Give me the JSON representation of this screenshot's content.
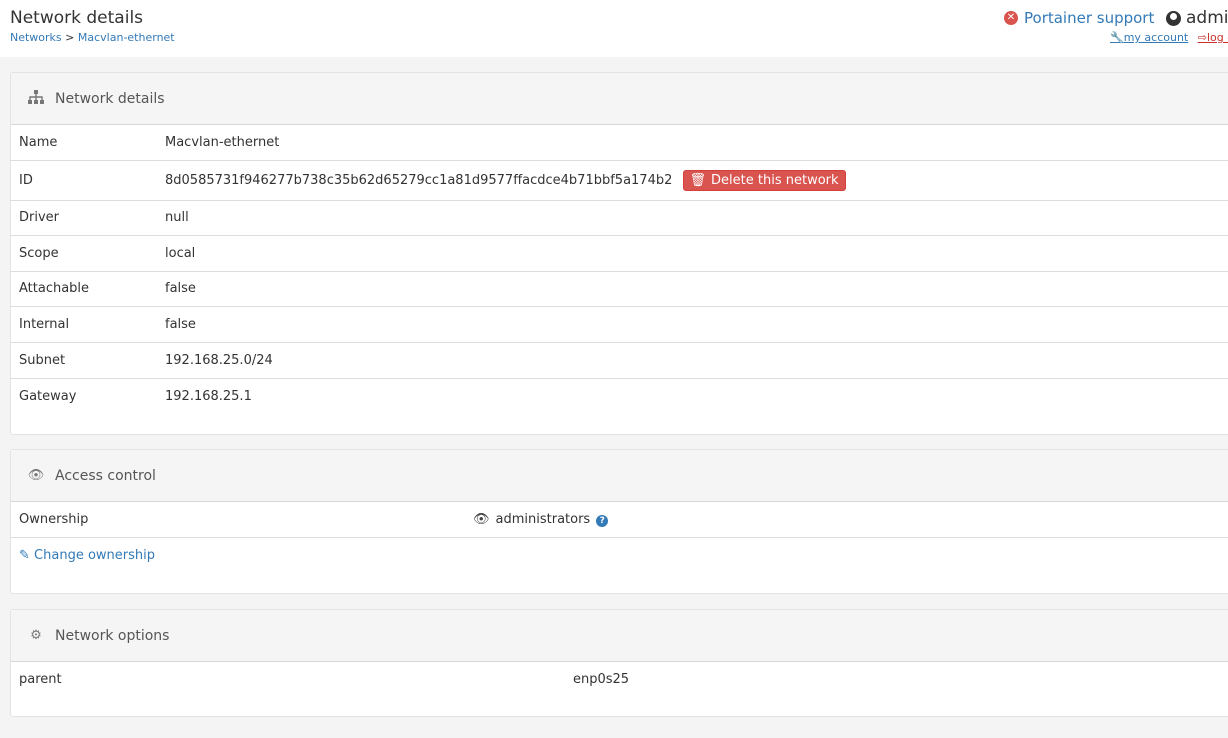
{
  "header": {
    "title": "Network details",
    "breadcrumb_root": "Networks",
    "breadcrumb_sep": ">",
    "breadcrumb_current": "Macvlan-ethernet",
    "support_label": "Portainer support",
    "username": "admi",
    "my_account": "my account",
    "logout": "log o"
  },
  "details": {
    "title": "Network details",
    "rows": {
      "name": {
        "label": "Name",
        "value": "Macvlan-ethernet"
      },
      "id": {
        "label": "ID",
        "value": "8d0585731f946277b738c35b62d65279cc1a81d9577ffacdce4b71bbf5a174b2"
      },
      "driver": {
        "label": "Driver",
        "value": "null"
      },
      "scope": {
        "label": "Scope",
        "value": "local"
      },
      "attachable": {
        "label": "Attachable",
        "value": "false"
      },
      "internal": {
        "label": "Internal",
        "value": "false"
      },
      "subnet": {
        "label": "Subnet",
        "value": "192.168.25.0/24"
      },
      "gateway": {
        "label": "Gateway",
        "value": "192.168.25.1"
      }
    },
    "delete_label": "Delete this network"
  },
  "access": {
    "title": "Access control",
    "ownership_label": "Ownership",
    "ownership_value": "administrators",
    "change_label": "Change ownership"
  },
  "options": {
    "title": "Network options",
    "rows": [
      {
        "key": "parent",
        "value": "enp0s25"
      }
    ]
  },
  "colors": {
    "link": "#337ab7",
    "danger": "#d9534f"
  }
}
